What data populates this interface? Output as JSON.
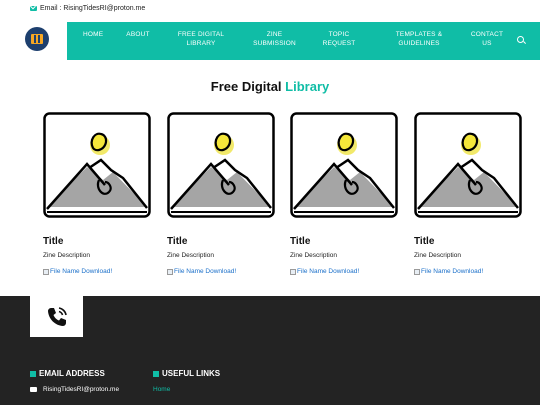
{
  "topbar": {
    "email_label": "Email : RisingTidesRI@proton.me",
    "email_icon": "envelope-icon"
  },
  "nav": {
    "items": [
      {
        "label": "HOME"
      },
      {
        "label": "ABOUT"
      },
      {
        "label": "FREE DIGITAL LIBRARY"
      },
      {
        "label": "ZINE SUBMISSION"
      },
      {
        "label": "TOPIC REQUEST"
      },
      {
        "label": "TEMPLATES & GUIDELINES"
      },
      {
        "label": "CONTACT US"
      }
    ],
    "search_icon": "search-icon",
    "logo_icon": "books-logo-icon"
  },
  "section": {
    "title_main": "Free Digital ",
    "title_accent": "Library"
  },
  "cards": [
    {
      "title": "Title",
      "description": "Zine Description",
      "download_text": "File Name Download!"
    },
    {
      "title": "Title",
      "description": "Zine Description",
      "download_text": "File Name Download!"
    },
    {
      "title": "Title",
      "description": "Zine Description",
      "download_text": "File Name Download!"
    },
    {
      "title": "Title",
      "description": "Zine Description",
      "download_text": "File Name Download!"
    }
  ],
  "footer": {
    "phone_icon": "phone-icon",
    "email_heading": "EMAIL ADDRESS",
    "links_heading": "USEFUL LINKS",
    "email_value": "RisingTidesRI@proton.me",
    "links": [
      {
        "label": "Home"
      }
    ]
  },
  "colors": {
    "accent": "#10bda6",
    "footer_bg": "#232323",
    "link": "#1a6fc9"
  }
}
